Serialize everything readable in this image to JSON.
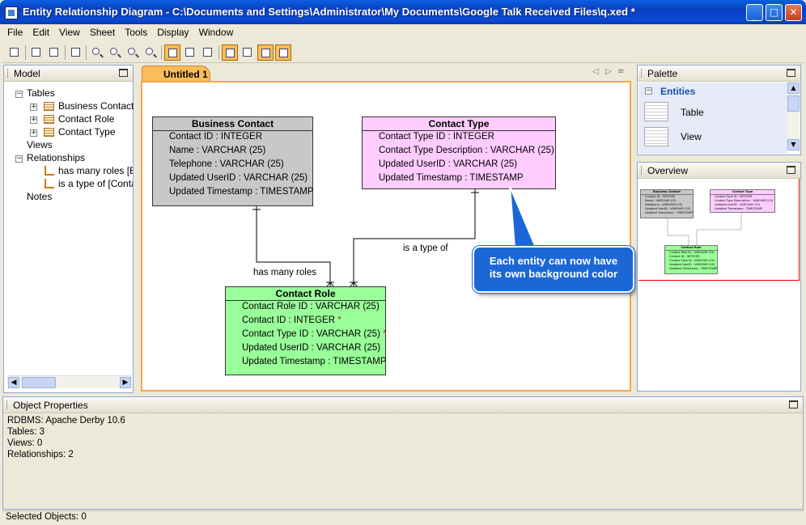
{
  "window": {
    "title": "Entity Relationship Diagram - C:\\Documents and Settings\\Administrator\\My Documents\\Google Talk Received Files\\q.xed *"
  },
  "menu": [
    "File",
    "Edit",
    "View",
    "Sheet",
    "Tools",
    "Display",
    "Window"
  ],
  "model_panel": {
    "title": "Model",
    "tree": {
      "tables_label": "Tables",
      "tables": [
        "Business Contact",
        "Contact Role",
        "Contact Type"
      ],
      "views_label": "Views",
      "relationships_label": "Relationships",
      "relationships": [
        "has many roles [Bu",
        "is a type of [Conta"
      ],
      "notes_label": "Notes"
    }
  },
  "editor": {
    "tab_label": "Untitled 1",
    "entities": {
      "business_contact": {
        "title": "Business Contact",
        "color": "#c8c8c8",
        "rows": [
          "Contact ID : INTEGER",
          "Name : VARCHAR (25)",
          "Telephone : VARCHAR (25)",
          "Updated UserID : VARCHAR (25)",
          "Updated Timestamp : TIMESTAMP"
        ]
      },
      "contact_type": {
        "title": "Contact Type",
        "color": "#ffccff",
        "rows": [
          "Contact Type ID : INTEGER",
          "Contact Type Description : VARCHAR (25)",
          "Updated UserID : VARCHAR (25)",
          "Updated Timestamp : TIMESTAMP"
        ]
      },
      "contact_role": {
        "title": "Contact Role",
        "color": "#99ff99",
        "rows": [
          "Contact Role ID : VARCHAR (25)",
          "Contact ID : INTEGER",
          "Contact Type ID : VARCHAR (25)",
          "Updated UserID : VARCHAR (25)",
          "Updated Timestamp : TIMESTAMP"
        ],
        "fk_mark": "*"
      }
    },
    "relationship_labels": {
      "has_many_roles": "has many roles",
      "is_a_type_of": "is a type of"
    },
    "callout_line1": "Each entity can now have",
    "callout_line2": "its own background color"
  },
  "palette_panel": {
    "title": "Palette",
    "section": "Entities",
    "items": [
      "Table",
      "View"
    ]
  },
  "overview_panel": {
    "title": "Overview"
  },
  "properties_panel": {
    "title": "Object Properties",
    "lines": [
      "RDBMS: Apache Derby 10.6",
      "Tables: 3",
      "Views: 0",
      "Relationships: 2"
    ]
  },
  "status": {
    "text": "Selected Objects: 0"
  },
  "colors": {
    "titlebar": "#0b3fbf",
    "accent": "#fdbc5a",
    "callout": "#1c67d6"
  }
}
